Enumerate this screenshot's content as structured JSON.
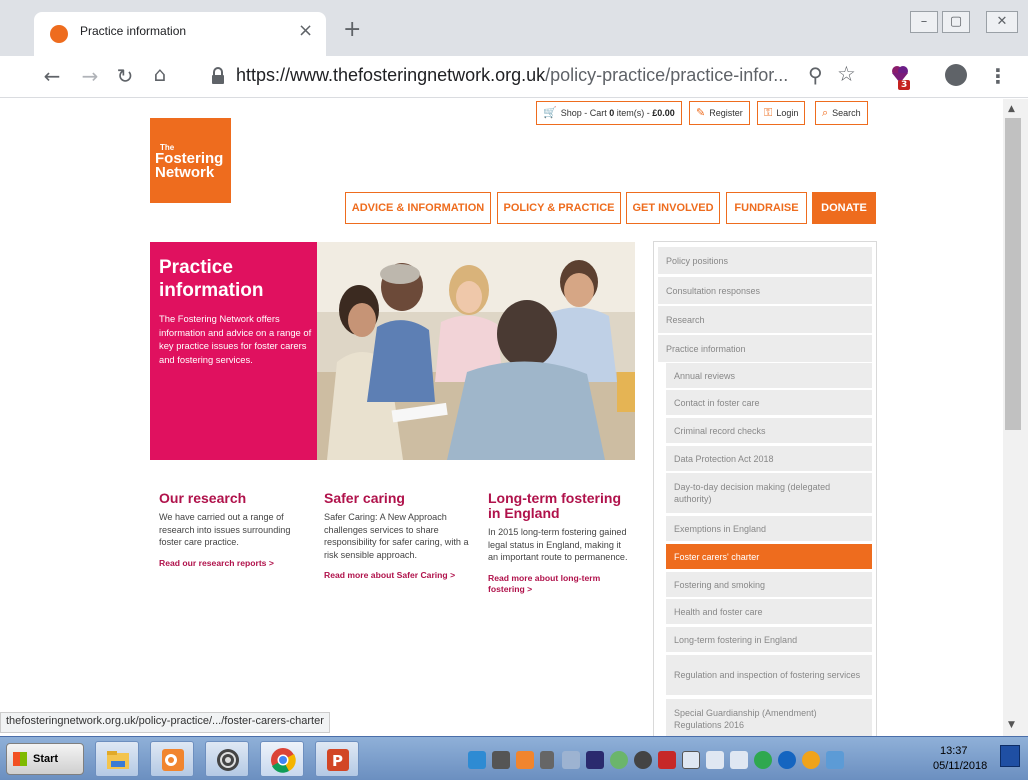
{
  "browser": {
    "tab_title": "Practice information",
    "tab_close": "×",
    "new_tab": "+",
    "url_domain": "https://www.thefosteringnetwork.org.uk",
    "url_path": "/policy-practice/practice-infor...",
    "extension_badge": "3",
    "min_label": "–",
    "restore_label": "▢",
    "close_label": "✕"
  },
  "site": {
    "brand_colors": {
      "orange": "#ee6c1e",
      "pink": "#e0115f",
      "crimson": "#b0124b"
    },
    "logo_line1": "The",
    "logo_line2": "Fostering",
    "logo_line3": "Network",
    "util": {
      "cart_prefix": "Shop - Cart ",
      "cart_count": "0",
      "cart_mid": " item(s) - ",
      "cart_total": "£0.00",
      "register": "Register",
      "login": "Login",
      "search": "Search"
    },
    "nav": [
      {
        "label": "ADVICE & INFORMATION"
      },
      {
        "label": "POLICY & PRACTICE"
      },
      {
        "label": "GET INVOLVED"
      },
      {
        "label": "FUNDRAISE"
      },
      {
        "label": "DONATE"
      }
    ]
  },
  "hero": {
    "title_line1": "Practice",
    "title_line2": "information",
    "text": "The Fostering Network offers information and advice on a range of key practice issues for foster carers and fostering services."
  },
  "columns": [
    {
      "title": "Our research",
      "body": "We have carried out a range of research into issues surrounding foster care practice.",
      "link": "Read our research reports >"
    },
    {
      "title": "Safer caring",
      "body": "Safer Caring: A New Approach challenges services to share responsibility for safer caring, with a risk sensible approach.",
      "link": "Read more about Safer Caring >"
    },
    {
      "title": "Long-term fostering in England",
      "body": "In 2015 long-term fostering gained legal status in England, making it an important route to permanence.",
      "link": "Read more about long-term fostering >"
    }
  ],
  "sidebar": {
    "items": [
      {
        "label": "Policy positions"
      },
      {
        "label": "Consultation responses"
      },
      {
        "label": "Research"
      },
      {
        "label": "Practice information"
      },
      {
        "label": "Annual reviews"
      },
      {
        "label": "Contact in foster care"
      },
      {
        "label": "Criminal record checks"
      },
      {
        "label": "Data Protection Act 2018"
      },
      {
        "label": "Day-to-day decision making (delegated authority)"
      },
      {
        "label": "Exemptions in England"
      },
      {
        "label": "Foster carers' charter"
      },
      {
        "label": "Fostering and smoking"
      },
      {
        "label": "Health and foster care"
      },
      {
        "label": "Long-term fostering in England"
      },
      {
        "label": "Regulation and inspection of fostering services"
      },
      {
        "label": "Special Guardianship (Amendment) Regulations 2016"
      }
    ]
  },
  "status_url": "thefosteringnetwork.org.uk/policy-practice/.../foster-carers-charter",
  "taskbar": {
    "start_label": "Start",
    "clock_time": "13:37",
    "clock_date": "05/11/2018"
  }
}
